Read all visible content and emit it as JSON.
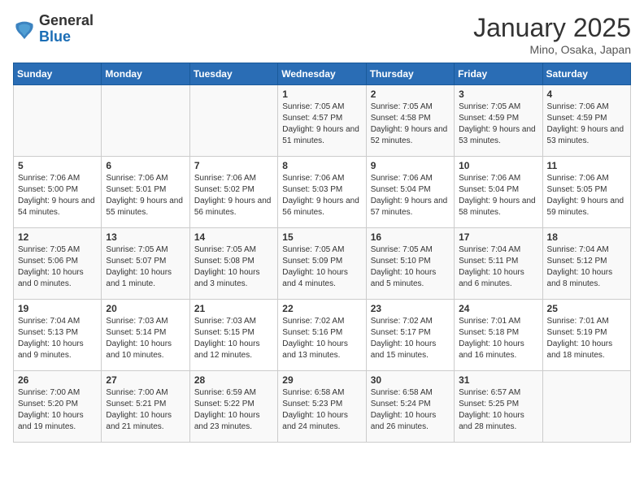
{
  "logo": {
    "line1": "General",
    "line2": "Blue"
  },
  "title": "January 2025",
  "subtitle": "Mino, Osaka, Japan",
  "headers": [
    "Sunday",
    "Monday",
    "Tuesday",
    "Wednesday",
    "Thursday",
    "Friday",
    "Saturday"
  ],
  "weeks": [
    [
      {
        "day": "",
        "text": ""
      },
      {
        "day": "",
        "text": ""
      },
      {
        "day": "",
        "text": ""
      },
      {
        "day": "1",
        "text": "Sunrise: 7:05 AM\nSunset: 4:57 PM\nDaylight: 9 hours and 51 minutes."
      },
      {
        "day": "2",
        "text": "Sunrise: 7:05 AM\nSunset: 4:58 PM\nDaylight: 9 hours and 52 minutes."
      },
      {
        "day": "3",
        "text": "Sunrise: 7:05 AM\nSunset: 4:59 PM\nDaylight: 9 hours and 53 minutes."
      },
      {
        "day": "4",
        "text": "Sunrise: 7:06 AM\nSunset: 4:59 PM\nDaylight: 9 hours and 53 minutes."
      }
    ],
    [
      {
        "day": "5",
        "text": "Sunrise: 7:06 AM\nSunset: 5:00 PM\nDaylight: 9 hours and 54 minutes."
      },
      {
        "day": "6",
        "text": "Sunrise: 7:06 AM\nSunset: 5:01 PM\nDaylight: 9 hours and 55 minutes."
      },
      {
        "day": "7",
        "text": "Sunrise: 7:06 AM\nSunset: 5:02 PM\nDaylight: 9 hours and 56 minutes."
      },
      {
        "day": "8",
        "text": "Sunrise: 7:06 AM\nSunset: 5:03 PM\nDaylight: 9 hours and 56 minutes."
      },
      {
        "day": "9",
        "text": "Sunrise: 7:06 AM\nSunset: 5:04 PM\nDaylight: 9 hours and 57 minutes."
      },
      {
        "day": "10",
        "text": "Sunrise: 7:06 AM\nSunset: 5:04 PM\nDaylight: 9 hours and 58 minutes."
      },
      {
        "day": "11",
        "text": "Sunrise: 7:06 AM\nSunset: 5:05 PM\nDaylight: 9 hours and 59 minutes."
      }
    ],
    [
      {
        "day": "12",
        "text": "Sunrise: 7:05 AM\nSunset: 5:06 PM\nDaylight: 10 hours and 0 minutes."
      },
      {
        "day": "13",
        "text": "Sunrise: 7:05 AM\nSunset: 5:07 PM\nDaylight: 10 hours and 1 minute."
      },
      {
        "day": "14",
        "text": "Sunrise: 7:05 AM\nSunset: 5:08 PM\nDaylight: 10 hours and 3 minutes."
      },
      {
        "day": "15",
        "text": "Sunrise: 7:05 AM\nSunset: 5:09 PM\nDaylight: 10 hours and 4 minutes."
      },
      {
        "day": "16",
        "text": "Sunrise: 7:05 AM\nSunset: 5:10 PM\nDaylight: 10 hours and 5 minutes."
      },
      {
        "day": "17",
        "text": "Sunrise: 7:04 AM\nSunset: 5:11 PM\nDaylight: 10 hours and 6 minutes."
      },
      {
        "day": "18",
        "text": "Sunrise: 7:04 AM\nSunset: 5:12 PM\nDaylight: 10 hours and 8 minutes."
      }
    ],
    [
      {
        "day": "19",
        "text": "Sunrise: 7:04 AM\nSunset: 5:13 PM\nDaylight: 10 hours and 9 minutes."
      },
      {
        "day": "20",
        "text": "Sunrise: 7:03 AM\nSunset: 5:14 PM\nDaylight: 10 hours and 10 minutes."
      },
      {
        "day": "21",
        "text": "Sunrise: 7:03 AM\nSunset: 5:15 PM\nDaylight: 10 hours and 12 minutes."
      },
      {
        "day": "22",
        "text": "Sunrise: 7:02 AM\nSunset: 5:16 PM\nDaylight: 10 hours and 13 minutes."
      },
      {
        "day": "23",
        "text": "Sunrise: 7:02 AM\nSunset: 5:17 PM\nDaylight: 10 hours and 15 minutes."
      },
      {
        "day": "24",
        "text": "Sunrise: 7:01 AM\nSunset: 5:18 PM\nDaylight: 10 hours and 16 minutes."
      },
      {
        "day": "25",
        "text": "Sunrise: 7:01 AM\nSunset: 5:19 PM\nDaylight: 10 hours and 18 minutes."
      }
    ],
    [
      {
        "day": "26",
        "text": "Sunrise: 7:00 AM\nSunset: 5:20 PM\nDaylight: 10 hours and 19 minutes."
      },
      {
        "day": "27",
        "text": "Sunrise: 7:00 AM\nSunset: 5:21 PM\nDaylight: 10 hours and 21 minutes."
      },
      {
        "day": "28",
        "text": "Sunrise: 6:59 AM\nSunset: 5:22 PM\nDaylight: 10 hours and 23 minutes."
      },
      {
        "day": "29",
        "text": "Sunrise: 6:58 AM\nSunset: 5:23 PM\nDaylight: 10 hours and 24 minutes."
      },
      {
        "day": "30",
        "text": "Sunrise: 6:58 AM\nSunset: 5:24 PM\nDaylight: 10 hours and 26 minutes."
      },
      {
        "day": "31",
        "text": "Sunrise: 6:57 AM\nSunset: 5:25 PM\nDaylight: 10 hours and 28 minutes."
      },
      {
        "day": "",
        "text": ""
      }
    ]
  ]
}
